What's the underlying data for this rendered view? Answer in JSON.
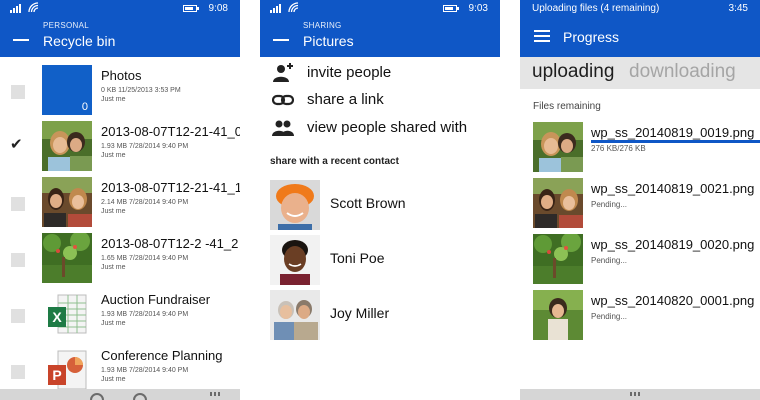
{
  "colors": {
    "accent": "#0f57c6",
    "pivot_bar": "#e5e5e5",
    "nav_bar": "#d6d6d6"
  },
  "phone1": {
    "status_time": "9:08",
    "eyebrow": "PERSONAL",
    "title": "Recycle bin",
    "items": [
      {
        "name": "Photos",
        "size": "0 KB",
        "date": "11/25/2013 3:53 PM",
        "who": "Just me",
        "count": "0",
        "kind": "folder",
        "checked": false
      },
      {
        "name": "2013-08-07T12-21-41_0",
        "size": "1.93 MB",
        "date": "7/28/2014 9:40 PM",
        "who": "Just me",
        "kind": "photo",
        "checked": true
      },
      {
        "name": "2013-08-07T12-21-41_1",
        "size": "2.14 MB",
        "date": "7/28/2014 9:40 PM",
        "who": "Just me",
        "kind": "photo",
        "checked": false
      },
      {
        "name": "2013-08-07T12-2 -41_2",
        "size": "1.65 MB",
        "date": "7/28/2014 9:40 PM",
        "who": "Just me",
        "kind": "photo-tree",
        "checked": false
      },
      {
        "name": "Auction Fundraiser",
        "size": "1.93 MB",
        "date": "7/28/2014 9:40 PM",
        "who": "Just me",
        "kind": "excel",
        "checked": false
      },
      {
        "name": "Conference Planning",
        "size": "1.93 MB",
        "date": "7/28/2014 9:40 PM",
        "who": "Just me",
        "kind": "powerpoint",
        "checked": false
      }
    ],
    "icons": {
      "excel": "X",
      "powerpoint": "P"
    }
  },
  "phone2": {
    "status_time": "9:03",
    "eyebrow": "SHARING",
    "title": "Pictures",
    "actions": [
      {
        "label": "invite people",
        "icon": "add-person-icon"
      },
      {
        "label": "share a link",
        "icon": "link-icon"
      },
      {
        "label": "view people shared with",
        "icon": "people-icon"
      }
    ],
    "section_label": "share with a recent contact",
    "contacts": [
      {
        "name": "Scott Brown"
      },
      {
        "name": "Toni Poe"
      },
      {
        "name": "Joy Miller"
      }
    ]
  },
  "phone3": {
    "status_text": "Uploading files (4 remaining)",
    "status_time": "3:45",
    "title": "Progress",
    "pivots": [
      "uploading",
      "downloading"
    ],
    "section_label": "Files remaining",
    "files": [
      {
        "name": "wp_ss_20140819_0019.png",
        "status": "276 KB/276 KB",
        "progress": 1.0
      },
      {
        "name": "wp_ss_20140819_0021.png",
        "status": "Pending..."
      },
      {
        "name": "wp_ss_20140819_0020.png",
        "status": "Pending..."
      },
      {
        "name": "wp_ss_20140820_0001.png",
        "status": "Pending..."
      }
    ]
  }
}
